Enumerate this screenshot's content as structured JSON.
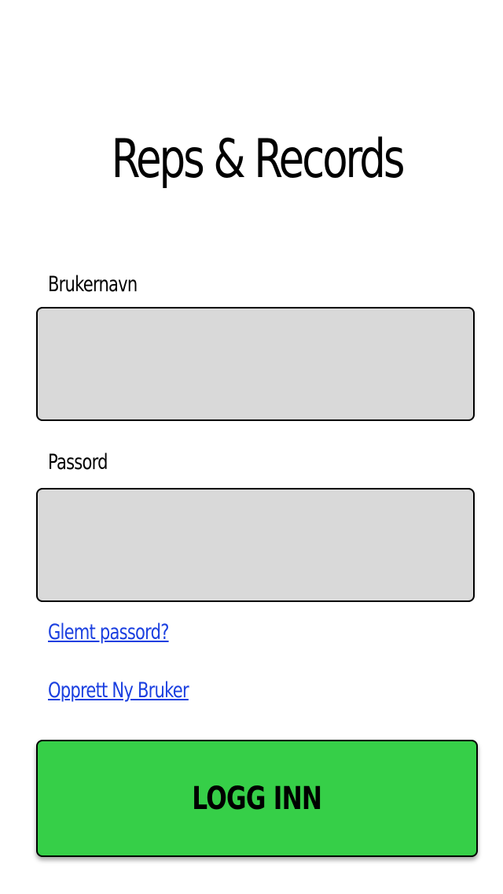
{
  "app": {
    "title": "Reps & Records"
  },
  "login_form": {
    "username_label": "Brukernavn",
    "username_value": "",
    "password_label": "Passord",
    "password_value": "",
    "forgot_password_link": "Glemt passord?",
    "create_user_link": "Opprett Ny Bruker",
    "login_button_label": "LOGG INN"
  },
  "colors": {
    "field_background": "#d9d9d9",
    "link": "#1a3fe0",
    "button_background": "#36cf48"
  }
}
